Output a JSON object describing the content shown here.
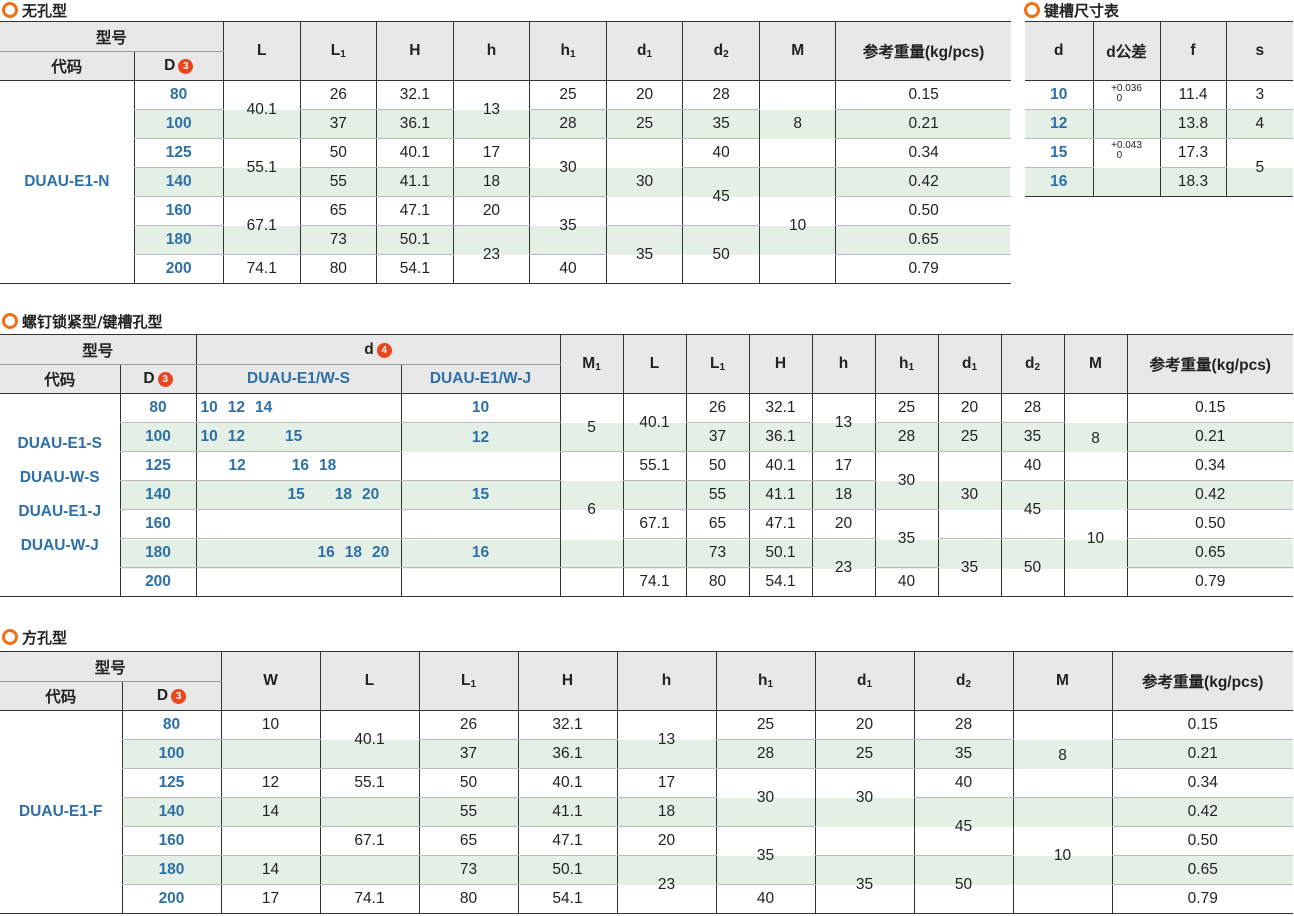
{
  "section1": {
    "title": "无孔型",
    "header": {
      "model": "型号",
      "code": "代码",
      "D": "D",
      "D_badge": "3",
      "L": "L",
      "L1": "L",
      "h": "h",
      "h1": "h",
      "H": "H",
      "d1": "d",
      "d2": "d",
      "M": "M",
      "weight": "参考重量(kg/pcs)",
      "sub1": "1",
      "sub2": "2"
    },
    "code": "DUAU-E1-N",
    "D": [
      "80",
      "100",
      "125",
      "140",
      "160",
      "180",
      "200"
    ],
    "L": [
      "40.1",
      "55.1",
      "67.1",
      "74.1"
    ],
    "L1": [
      "26",
      "37",
      "50",
      "55",
      "65",
      "73",
      "80"
    ],
    "H": [
      "32.1",
      "36.1",
      "40.1",
      "41.1",
      "47.1",
      "50.1",
      "54.1"
    ],
    "h": [
      "13",
      "17",
      "18",
      "20",
      "23"
    ],
    "h1": [
      "25",
      "28",
      "30",
      "35",
      "40"
    ],
    "d1": [
      "20",
      "25",
      "30",
      "35"
    ],
    "d2": [
      "28",
      "35",
      "40",
      "45",
      "50"
    ],
    "M": [
      "8",
      "10"
    ],
    "weight": [
      "0.15",
      "0.21",
      "0.34",
      "0.42",
      "0.50",
      "0.65",
      "0.79"
    ]
  },
  "keyslot": {
    "title": "键槽尺寸表",
    "header": {
      "d": "d",
      "dtol": "d公差",
      "f": "f",
      "s": "s"
    },
    "d": [
      "10",
      "12",
      "15",
      "16"
    ],
    "tol1": {
      "upper": "+0.036",
      "lower": "0"
    },
    "tol2": {
      "upper": "+0.043",
      "lower": "0"
    },
    "f": [
      "11.4",
      "13.8",
      "17.3",
      "18.3"
    ],
    "s": [
      "3",
      "4",
      "5"
    ]
  },
  "section2": {
    "title": "螺钉锁紧型/键槽孔型",
    "header": {
      "model": "型号",
      "code": "代码",
      "D": "D",
      "D_badge": "3",
      "d": "d",
      "d_badge": "4",
      "ws": "DUAU-E1/W-S",
      "wj": "DUAU-E1/W-J",
      "M1": "M",
      "L": "L",
      "L1": "L",
      "H": "H",
      "h": "h",
      "h1": "h",
      "d1": "d",
      "d2": "d",
      "M": "M",
      "weight": "参考重量(kg/pcs)",
      "sub1": "1",
      "sub2": "2"
    },
    "codes": [
      "DUAU-E1-S",
      "DUAU-W-S",
      "DUAU-E1-J",
      "DUAU-W-J"
    ],
    "D": [
      "80",
      "100",
      "125",
      "140",
      "160",
      "180",
      "200"
    ],
    "ws_rows": [
      [
        "10",
        "12",
        "14"
      ],
      [
        "10",
        "12",
        "15"
      ],
      [
        "12",
        "16",
        "18"
      ],
      [
        "15",
        "18",
        "20"
      ],
      [],
      [
        "16",
        "18",
        "20"
      ],
      []
    ],
    "wj": [
      "10",
      "12",
      "15",
      "16"
    ],
    "M1": [
      "5",
      "6"
    ],
    "L": [
      "40.1",
      "55.1",
      "67.1",
      "74.1"
    ],
    "L1": [
      "26",
      "37",
      "50",
      "55",
      "65",
      "73",
      "80"
    ],
    "H": [
      "32.1",
      "36.1",
      "40.1",
      "41.1",
      "47.1",
      "50.1",
      "54.1"
    ],
    "h": [
      "13",
      "17",
      "18",
      "20",
      "23"
    ],
    "h1": [
      "25",
      "28",
      "30",
      "35",
      "40"
    ],
    "d1": [
      "20",
      "25",
      "30",
      "35"
    ],
    "d2": [
      "28",
      "35",
      "40",
      "45",
      "50"
    ],
    "M": [
      "8",
      "10"
    ],
    "weight": [
      "0.15",
      "0.21",
      "0.34",
      "0.42",
      "0.50",
      "0.65",
      "0.79"
    ]
  },
  "section3": {
    "title": "方孔型",
    "header": {
      "model": "型号",
      "code": "代码",
      "D": "D",
      "D_badge": "3",
      "W": "W",
      "L": "L",
      "L1": "L",
      "H": "H",
      "h": "h",
      "h1": "h",
      "d1": "d",
      "d2": "d",
      "M": "M",
      "weight": "参考重量(kg/pcs)",
      "sub1": "1",
      "sub2": "2"
    },
    "code": "DUAU-E1-F",
    "D": [
      "80",
      "100",
      "125",
      "140",
      "160",
      "180",
      "200"
    ],
    "W": [
      "10",
      "12",
      "14",
      "14",
      "17"
    ],
    "L": [
      "40.1",
      "55.1",
      "67.1",
      "74.1"
    ],
    "L1": [
      "26",
      "37",
      "50",
      "55",
      "65",
      "73",
      "80"
    ],
    "H": [
      "32.1",
      "36.1",
      "40.1",
      "41.1",
      "47.1",
      "50.1",
      "54.1"
    ],
    "h": [
      "13",
      "17",
      "18",
      "20",
      "23"
    ],
    "h1": [
      "25",
      "28",
      "30",
      "35",
      "40"
    ],
    "d1": [
      "20",
      "25",
      "30",
      "35"
    ],
    "d2": [
      "28",
      "35",
      "40",
      "45",
      "50"
    ],
    "M": [
      "8",
      "10"
    ],
    "weight": [
      "0.15",
      "0.21",
      "0.34",
      "0.42",
      "0.50",
      "0.65",
      "0.79"
    ]
  },
  "colors": {
    "accent": "#f07018",
    "badge": "#e8461c",
    "code_blue": "#2d6fa8",
    "band_green": "#e4f0e6",
    "header_gray": "#e8e8e8"
  }
}
